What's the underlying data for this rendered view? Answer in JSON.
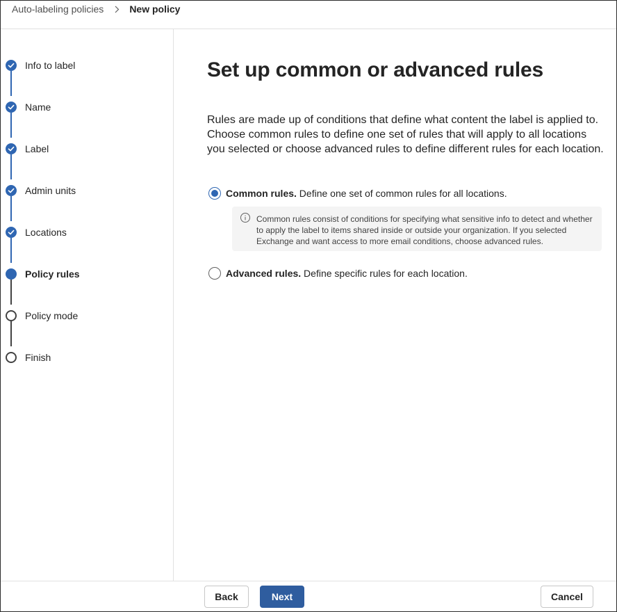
{
  "breadcrumb": {
    "parent": "Auto-labeling policies",
    "current": "New policy"
  },
  "steps": [
    {
      "label": "Info to label",
      "state": "completed"
    },
    {
      "label": "Name",
      "state": "completed"
    },
    {
      "label": "Label",
      "state": "completed"
    },
    {
      "label": "Admin units",
      "state": "completed"
    },
    {
      "label": "Locations",
      "state": "completed"
    },
    {
      "label": "Policy rules",
      "state": "current"
    },
    {
      "label": "Policy mode",
      "state": "upcoming"
    },
    {
      "label": "Finish",
      "state": "upcoming"
    }
  ],
  "main": {
    "title": "Set up common or advanced rules",
    "description": "Rules are made up of conditions that define what content the label is applied to. Choose common rules to define one set of rules that will apply to all locations you selected or choose advanced rules to define different rules for each location.",
    "options": [
      {
        "title": "Common rules.",
        "text": "Define one set of common rules for all locations.",
        "selected": true
      },
      {
        "title": "Advanced rules.",
        "text": "Define specific rules for each location.",
        "selected": false
      }
    ],
    "info": "Common rules consist of conditions for specifying what sensitive info to detect and whether to apply the label to items shared inside or outside your organization. If you selected Exchange and want access to more email conditions, choose advanced rules."
  },
  "footer": {
    "back_label": "Back",
    "next_label": "Next",
    "cancel_label": "Cancel"
  },
  "colors": {
    "accent": "#2f66b2",
    "primary_button": "#2f5d9f",
    "info_background": "#f4f4f4"
  },
  "icons": {
    "breadcrumb_separator": "chevron-right-icon",
    "completed_step": "checkmark-icon",
    "info": "info-icon"
  }
}
